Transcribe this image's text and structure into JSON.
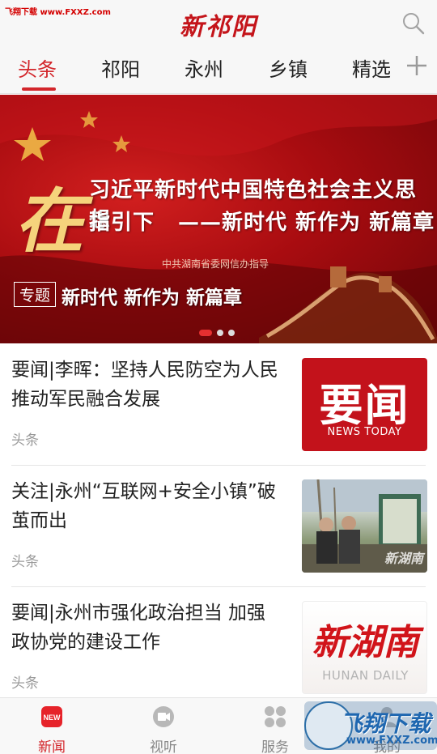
{
  "header": {
    "watermark": "飞翔下载 www.FXXZ.com",
    "logo": "新祁阳"
  },
  "tabs": [
    {
      "label": "头条",
      "active": true
    },
    {
      "label": "祁阳",
      "active": false
    },
    {
      "label": "永州",
      "active": false
    },
    {
      "label": "乡镇",
      "active": false
    },
    {
      "label": "精选",
      "active": false
    }
  ],
  "banner": {
    "big_char": "在",
    "line1": "习近平新时代中国特色社会主义思想",
    "line2a": "指引下",
    "line2b": "——新时代 新作为 新篇章",
    "guide": "中共湖南省委网信办指导",
    "tag": "专题",
    "caption": "新时代 新作为 新篇章",
    "slide_count": 3,
    "active_slide": 1
  },
  "news": [
    {
      "title": "要闻|李晖：坚持人民防空为人民 推动军民融合发展",
      "source": "头条",
      "thumb": {
        "big": "要闻",
        "small": "NEWS TODAY"
      }
    },
    {
      "title": "关注|永州“互联网+安全小镇”破茧而出",
      "source": "头条",
      "thumb": {
        "watermark": "新湖南"
      }
    },
    {
      "title": "要闻|永州市强化政治担当 加强政协党的建设工作",
      "source": "头条",
      "thumb": {
        "big": "新湖南",
        "small": "HUNAN DAILY"
      }
    }
  ],
  "bottom_nav": [
    {
      "label": "新闻",
      "icon": "news-icon",
      "active": true
    },
    {
      "label": "视听",
      "icon": "video-icon",
      "active": false
    },
    {
      "label": "服务",
      "icon": "grid-icon",
      "active": false
    },
    {
      "label": "我的",
      "icon": "user-icon",
      "active": false
    }
  ],
  "site_watermark": {
    "text": "飞翔下载",
    "url": "www.FXXZ.com"
  },
  "colors": {
    "accent": "#d3262b",
    "banner_red": "#a80c10",
    "gold": "#f5d37c"
  }
}
